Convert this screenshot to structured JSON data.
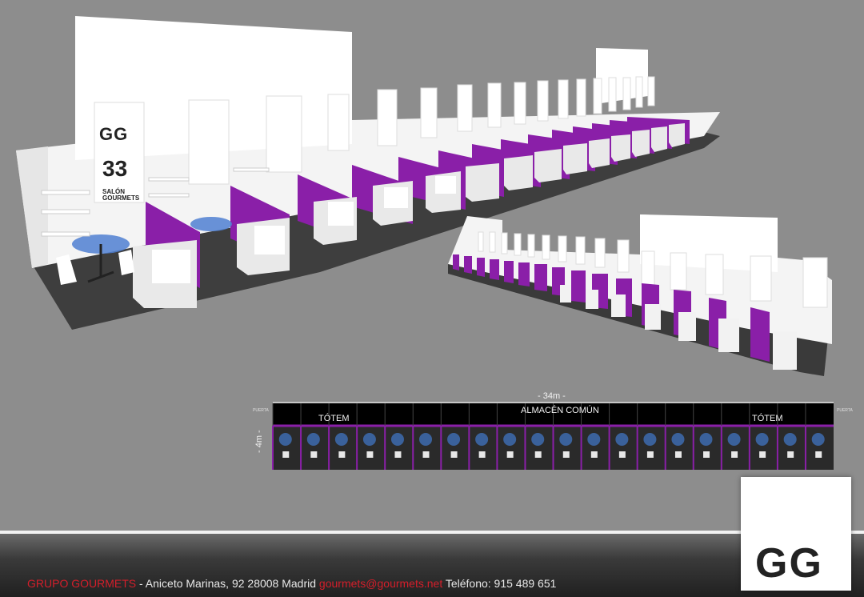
{
  "plan": {
    "width_label": "- 34m -",
    "depth_label": "- 4m -",
    "storage_label": "ALMACÉN COMÚN",
    "totem_left": "TÓTEM",
    "totem_right": "TÓTEM",
    "door_left": "PUERTA",
    "door_right": "PUERTA",
    "stand_count": 20
  },
  "banner": {
    "logo_letters": "GG",
    "number": "33",
    "name_line1": "SALÓN",
    "name_line2": "GOURMETS"
  },
  "footer": {
    "company": "GRUPO GOURMETS",
    "address": " - Aniceto Marinas, 92 28008 Madrid ",
    "email": "gourmets@gourmets.net",
    "phone": " Teléfono: 915 489 651"
  },
  "colors": {
    "accent_purple": "#8a1fa8",
    "background_gray": "#8d8d8d",
    "brand_red": "#d41e2a"
  }
}
